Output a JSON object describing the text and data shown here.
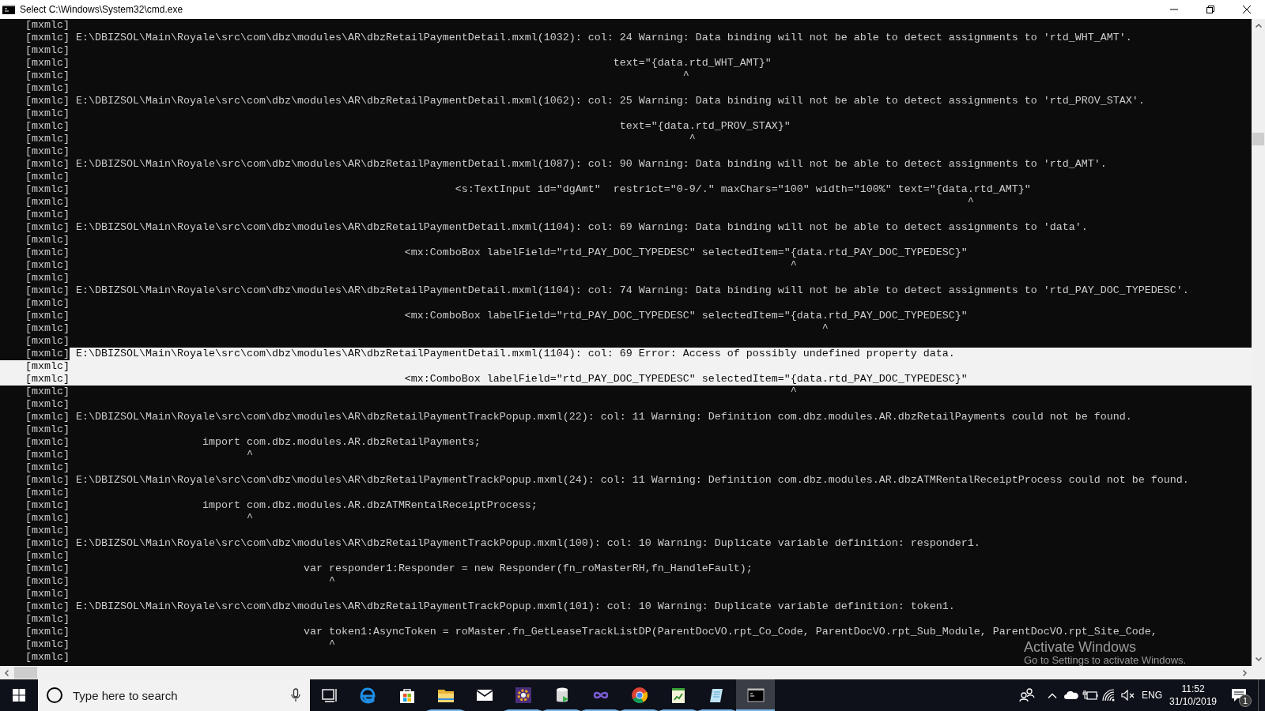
{
  "window": {
    "title": "Select C:\\Windows\\System32\\cmd.exe"
  },
  "console": {
    "lines": [
      {
        "prefix": "[mxmlc]",
        "selected": false
      },
      {
        "prefix": "[mxmlc]",
        "text": "E:\\DBIZSOL\\Main\\Royale\\src\\com\\dbz\\modules\\AR\\dbzRetailPaymentDetail.mxml(1032): col: 24 Warning: Data binding will not be able to detect assignments to 'rtd_WHT_AMT'.",
        "selected": false
      },
      {
        "prefix": "[mxmlc]",
        "selected": false
      },
      {
        "prefix": "[mxmlc]",
        "text": "                                                                                     text=\"{data.rtd_WHT_AMT}\"",
        "selected": false
      },
      {
        "prefix": "[mxmlc]",
        "text": "                                                                                                ^",
        "selected": false
      },
      {
        "prefix": "[mxmlc]",
        "selected": false
      },
      {
        "prefix": "[mxmlc]",
        "text": "E:\\DBIZSOL\\Main\\Royale\\src\\com\\dbz\\modules\\AR\\dbzRetailPaymentDetail.mxml(1062): col: 25 Warning: Data binding will not be able to detect assignments to 'rtd_PROV_STAX'.",
        "selected": false
      },
      {
        "prefix": "[mxmlc]",
        "selected": false
      },
      {
        "prefix": "[mxmlc]",
        "text": "                                                                                      text=\"{data.rtd_PROV_STAX}\"",
        "selected": false
      },
      {
        "prefix": "[mxmlc]",
        "text": "                                                                                                 ^",
        "selected": false
      },
      {
        "prefix": "[mxmlc]",
        "selected": false
      },
      {
        "prefix": "[mxmlc]",
        "text": "E:\\DBIZSOL\\Main\\Royale\\src\\com\\dbz\\modules\\AR\\dbzRetailPaymentDetail.mxml(1087): col: 90 Warning: Data binding will not be able to detect assignments to 'rtd_AMT'.",
        "selected": false
      },
      {
        "prefix": "[mxmlc]",
        "selected": false
      },
      {
        "prefix": "[mxmlc]",
        "text": "                                                            <s:TextInput id=\"dgAmt\"  restrict=\"0-9/.\" maxChars=\"100\" width=\"100%\" text=\"{data.rtd_AMT}\"",
        "selected": false
      },
      {
        "prefix": "[mxmlc]",
        "text": "                                                                                                                                             ^",
        "selected": false
      },
      {
        "prefix": "[mxmlc]",
        "selected": false
      },
      {
        "prefix": "[mxmlc]",
        "text": "E:\\DBIZSOL\\Main\\Royale\\src\\com\\dbz\\modules\\AR\\dbzRetailPaymentDetail.mxml(1104): col: 69 Warning: Data binding will not be able to detect assignments to 'data'.",
        "selected": false
      },
      {
        "prefix": "[mxmlc]",
        "selected": false
      },
      {
        "prefix": "[mxmlc]",
        "text": "                                                    <mx:ComboBox labelField=\"rtd_PAY_DOC_TYPEDESC\" selectedItem=\"{data.rtd_PAY_DOC_TYPEDESC}\"",
        "selected": false
      },
      {
        "prefix": "[mxmlc]",
        "text": "                                                                                                                 ^",
        "selected": false
      },
      {
        "prefix": "[mxmlc]",
        "selected": false
      },
      {
        "prefix": "[mxmlc]",
        "text": "E:\\DBIZSOL\\Main\\Royale\\src\\com\\dbz\\modules\\AR\\dbzRetailPaymentDetail.mxml(1104): col: 74 Warning: Data binding will not be able to detect assignments to 'rtd_PAY_DOC_TYPEDESC'.",
        "selected": false
      },
      {
        "prefix": "[mxmlc]",
        "selected": false
      },
      {
        "prefix": "[mxmlc]",
        "text": "                                                    <mx:ComboBox labelField=\"rtd_PAY_DOC_TYPEDESC\" selectedItem=\"{data.rtd_PAY_DOC_TYPEDESC}\"",
        "selected": false
      },
      {
        "prefix": "[mxmlc]",
        "text": "                                                                                                                      ^",
        "selected": false
      },
      {
        "prefix": "[mxmlc]",
        "selected": false
      },
      {
        "prefix": "[mxmlc]",
        "text": "E:\\DBIZSOL\\Main\\Royale\\src\\com\\dbz\\modules\\AR\\dbzRetailPaymentDetail.mxml(1104): col: 69 Error: Access of possibly undefined property data.",
        "selected": true
      },
      {
        "prefix": "[mxmlc]",
        "selected": true
      },
      {
        "prefix": "[mxmlc]",
        "text": "                                                    <mx:ComboBox labelField=\"rtd_PAY_DOC_TYPEDESC\" selectedItem=\"{data.rtd_PAY_DOC_TYPEDESC}\"",
        "selected": true
      },
      {
        "prefix": "[mxmlc]",
        "text": "                                                                                                                 ^",
        "selected": false
      },
      {
        "prefix": "[mxmlc]",
        "selected": false
      },
      {
        "prefix": "[mxmlc]",
        "text": "E:\\DBIZSOL\\Main\\Royale\\src\\com\\dbz\\modules\\AR\\dbzRetailPaymentTrackPopup.mxml(22): col: 11 Warning: Definition com.dbz.modules.AR.dbzRetailPayments could not be found.",
        "selected": false
      },
      {
        "prefix": "[mxmlc]",
        "selected": false
      },
      {
        "prefix": "[mxmlc]",
        "text": "                    import com.dbz.modules.AR.dbzRetailPayments;",
        "selected": false
      },
      {
        "prefix": "[mxmlc]",
        "text": "                           ^",
        "selected": false
      },
      {
        "prefix": "[mxmlc]",
        "selected": false
      },
      {
        "prefix": "[mxmlc]",
        "text": "E:\\DBIZSOL\\Main\\Royale\\src\\com\\dbz\\modules\\AR\\dbzRetailPaymentTrackPopup.mxml(24): col: 11 Warning: Definition com.dbz.modules.AR.dbzATMRentalReceiptProcess could not be found.",
        "selected": false
      },
      {
        "prefix": "[mxmlc]",
        "selected": false
      },
      {
        "prefix": "[mxmlc]",
        "text": "                    import com.dbz.modules.AR.dbzATMRentalReceiptProcess;",
        "selected": false
      },
      {
        "prefix": "[mxmlc]",
        "text": "                           ^",
        "selected": false
      },
      {
        "prefix": "[mxmlc]",
        "selected": false
      },
      {
        "prefix": "[mxmlc]",
        "text": "E:\\DBIZSOL\\Main\\Royale\\src\\com\\dbz\\modules\\AR\\dbzRetailPaymentTrackPopup.mxml(100): col: 10 Warning: Duplicate variable definition: responder1.",
        "selected": false
      },
      {
        "prefix": "[mxmlc]",
        "selected": false
      },
      {
        "prefix": "[mxmlc]",
        "text": "                                    var responder1:Responder = new Responder(fn_roMasterRH,fn_HandleFault);",
        "selected": false
      },
      {
        "prefix": "[mxmlc]",
        "text": "                                        ^",
        "selected": false
      },
      {
        "prefix": "[mxmlc]",
        "selected": false
      },
      {
        "prefix": "[mxmlc]",
        "text": "E:\\DBIZSOL\\Main\\Royale\\src\\com\\dbz\\modules\\AR\\dbzRetailPaymentTrackPopup.mxml(101): col: 10 Warning: Duplicate variable definition: token1.",
        "selected": false
      },
      {
        "prefix": "[mxmlc]",
        "selected": false
      },
      {
        "prefix": "[mxmlc]",
        "text": "                                    var token1:AsyncToken = roMaster.fn_GetLeaseTrackListDP(ParentDocVO.rpt_Co_Code, ParentDocVO.rpt_Sub_Module, ParentDocVO.rpt_Site_Code,",
        "selected": false
      },
      {
        "prefix": "[mxmlc]",
        "text": "                                        ^",
        "selected": false
      },
      {
        "prefix": "[mxmlc]",
        "selected": false
      }
    ]
  },
  "activation_notice": {
    "title": "Activate Windows",
    "hint": "Go to Settings to activate Windows."
  },
  "taskbar": {
    "search": {
      "placeholder": "Type here to search"
    },
    "apps": [
      {
        "kind": "task-view",
        "running": false,
        "selected": false
      },
      {
        "kind": "browser-e",
        "running": false,
        "selected": false
      },
      {
        "kind": "store",
        "running": false,
        "selected": false
      },
      {
        "kind": "folder",
        "running": true,
        "selected": false
      },
      {
        "kind": "mail",
        "running": false,
        "selected": false
      },
      {
        "kind": "gear-ide",
        "running": true,
        "selected": false
      },
      {
        "kind": "database",
        "running": true,
        "selected": false
      },
      {
        "kind": "infinity",
        "running": true,
        "selected": false
      },
      {
        "kind": "browser-ring",
        "running": true,
        "selected": false
      },
      {
        "kind": "chart-pad",
        "running": true,
        "selected": false
      },
      {
        "kind": "notepad",
        "running": true,
        "selected": false
      },
      {
        "kind": "terminal",
        "running": true,
        "selected": true
      }
    ],
    "tray": {
      "language": "ENG",
      "time": "11:52",
      "date": "31/10/2019",
      "notification_count": "1"
    }
  }
}
